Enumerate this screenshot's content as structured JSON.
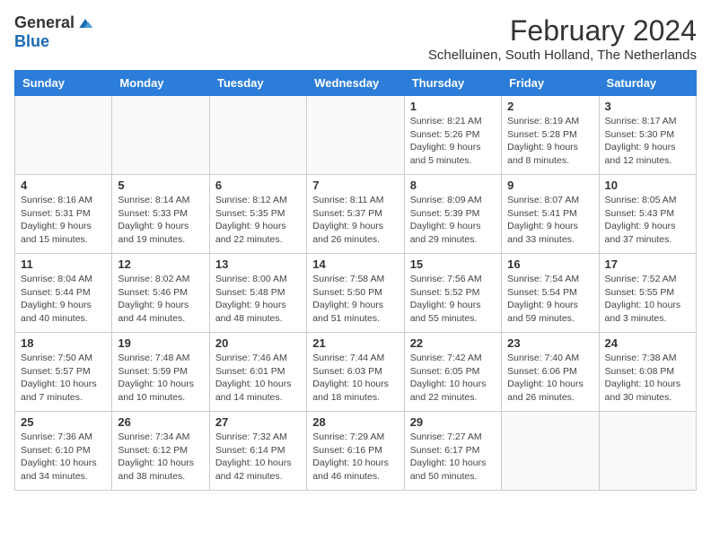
{
  "header": {
    "logo_general": "General",
    "logo_blue": "Blue",
    "month_title": "February 2024",
    "subtitle": "Schelluinen, South Holland, The Netherlands"
  },
  "weekdays": [
    "Sunday",
    "Monday",
    "Tuesday",
    "Wednesday",
    "Thursday",
    "Friday",
    "Saturday"
  ],
  "weeks": [
    [
      {
        "day": "",
        "info": ""
      },
      {
        "day": "",
        "info": ""
      },
      {
        "day": "",
        "info": ""
      },
      {
        "day": "",
        "info": ""
      },
      {
        "day": "1",
        "info": "Sunrise: 8:21 AM\nSunset: 5:26 PM\nDaylight: 9 hours\nand 5 minutes."
      },
      {
        "day": "2",
        "info": "Sunrise: 8:19 AM\nSunset: 5:28 PM\nDaylight: 9 hours\nand 8 minutes."
      },
      {
        "day": "3",
        "info": "Sunrise: 8:17 AM\nSunset: 5:30 PM\nDaylight: 9 hours\nand 12 minutes."
      }
    ],
    [
      {
        "day": "4",
        "info": "Sunrise: 8:16 AM\nSunset: 5:31 PM\nDaylight: 9 hours\nand 15 minutes."
      },
      {
        "day": "5",
        "info": "Sunrise: 8:14 AM\nSunset: 5:33 PM\nDaylight: 9 hours\nand 19 minutes."
      },
      {
        "day": "6",
        "info": "Sunrise: 8:12 AM\nSunset: 5:35 PM\nDaylight: 9 hours\nand 22 minutes."
      },
      {
        "day": "7",
        "info": "Sunrise: 8:11 AM\nSunset: 5:37 PM\nDaylight: 9 hours\nand 26 minutes."
      },
      {
        "day": "8",
        "info": "Sunrise: 8:09 AM\nSunset: 5:39 PM\nDaylight: 9 hours\nand 29 minutes."
      },
      {
        "day": "9",
        "info": "Sunrise: 8:07 AM\nSunset: 5:41 PM\nDaylight: 9 hours\nand 33 minutes."
      },
      {
        "day": "10",
        "info": "Sunrise: 8:05 AM\nSunset: 5:43 PM\nDaylight: 9 hours\nand 37 minutes."
      }
    ],
    [
      {
        "day": "11",
        "info": "Sunrise: 8:04 AM\nSunset: 5:44 PM\nDaylight: 9 hours\nand 40 minutes."
      },
      {
        "day": "12",
        "info": "Sunrise: 8:02 AM\nSunset: 5:46 PM\nDaylight: 9 hours\nand 44 minutes."
      },
      {
        "day": "13",
        "info": "Sunrise: 8:00 AM\nSunset: 5:48 PM\nDaylight: 9 hours\nand 48 minutes."
      },
      {
        "day": "14",
        "info": "Sunrise: 7:58 AM\nSunset: 5:50 PM\nDaylight: 9 hours\nand 51 minutes."
      },
      {
        "day": "15",
        "info": "Sunrise: 7:56 AM\nSunset: 5:52 PM\nDaylight: 9 hours\nand 55 minutes."
      },
      {
        "day": "16",
        "info": "Sunrise: 7:54 AM\nSunset: 5:54 PM\nDaylight: 9 hours\nand 59 minutes."
      },
      {
        "day": "17",
        "info": "Sunrise: 7:52 AM\nSunset: 5:55 PM\nDaylight: 10 hours\nand 3 minutes."
      }
    ],
    [
      {
        "day": "18",
        "info": "Sunrise: 7:50 AM\nSunset: 5:57 PM\nDaylight: 10 hours\nand 7 minutes."
      },
      {
        "day": "19",
        "info": "Sunrise: 7:48 AM\nSunset: 5:59 PM\nDaylight: 10 hours\nand 10 minutes."
      },
      {
        "day": "20",
        "info": "Sunrise: 7:46 AM\nSunset: 6:01 PM\nDaylight: 10 hours\nand 14 minutes."
      },
      {
        "day": "21",
        "info": "Sunrise: 7:44 AM\nSunset: 6:03 PM\nDaylight: 10 hours\nand 18 minutes."
      },
      {
        "day": "22",
        "info": "Sunrise: 7:42 AM\nSunset: 6:05 PM\nDaylight: 10 hours\nand 22 minutes."
      },
      {
        "day": "23",
        "info": "Sunrise: 7:40 AM\nSunset: 6:06 PM\nDaylight: 10 hours\nand 26 minutes."
      },
      {
        "day": "24",
        "info": "Sunrise: 7:38 AM\nSunset: 6:08 PM\nDaylight: 10 hours\nand 30 minutes."
      }
    ],
    [
      {
        "day": "25",
        "info": "Sunrise: 7:36 AM\nSunset: 6:10 PM\nDaylight: 10 hours\nand 34 minutes."
      },
      {
        "day": "26",
        "info": "Sunrise: 7:34 AM\nSunset: 6:12 PM\nDaylight: 10 hours\nand 38 minutes."
      },
      {
        "day": "27",
        "info": "Sunrise: 7:32 AM\nSunset: 6:14 PM\nDaylight: 10 hours\nand 42 minutes."
      },
      {
        "day": "28",
        "info": "Sunrise: 7:29 AM\nSunset: 6:16 PM\nDaylight: 10 hours\nand 46 minutes."
      },
      {
        "day": "29",
        "info": "Sunrise: 7:27 AM\nSunset: 6:17 PM\nDaylight: 10 hours\nand 50 minutes."
      },
      {
        "day": "",
        "info": ""
      },
      {
        "day": "",
        "info": ""
      }
    ]
  ]
}
